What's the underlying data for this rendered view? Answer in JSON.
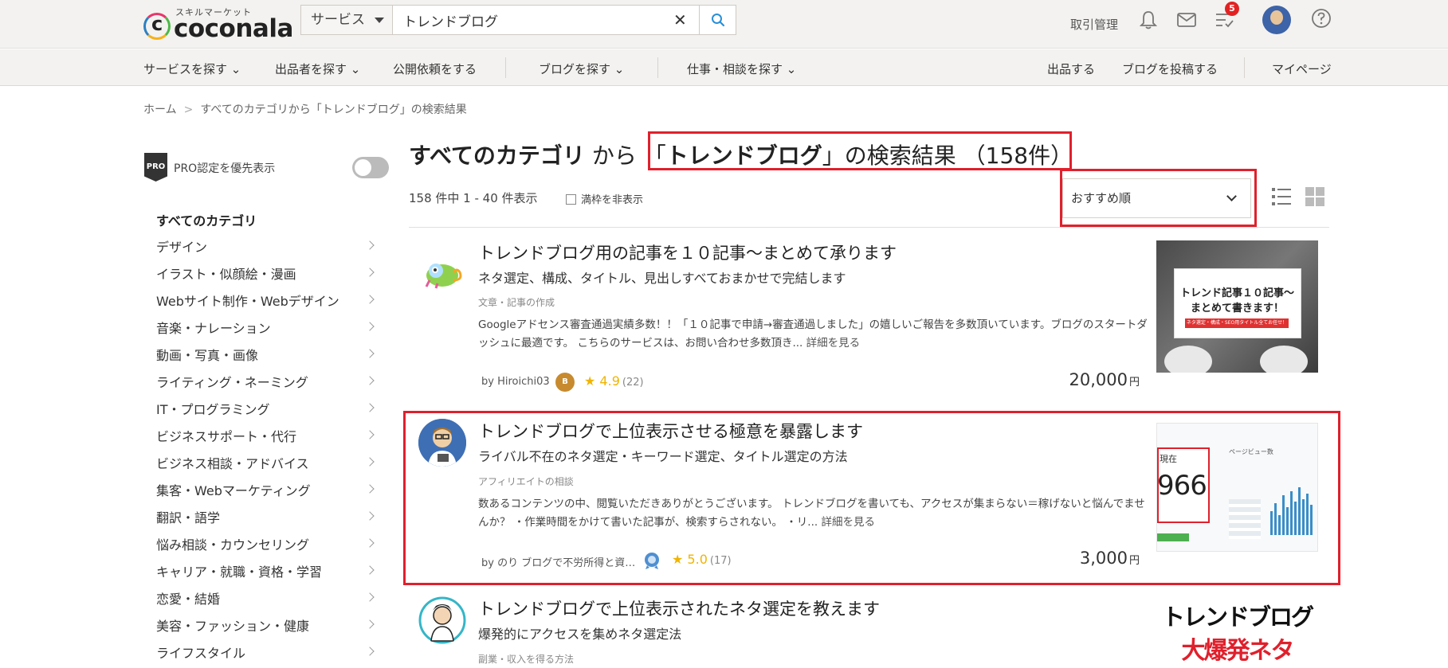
{
  "header": {
    "logo_sub": "スキルマーケット",
    "logo_text": "coconala",
    "search_category": "サービス",
    "search_value": "トレンドブログ",
    "trade_link": "取引管理",
    "notification_count": "5"
  },
  "nav": {
    "items": [
      "サービスを探す",
      "出品者を探す",
      "公開依頼をする",
      "ブログを探す",
      "仕事・相談を探す"
    ],
    "right_items": [
      "出品する",
      "ブログを投稿する",
      "マイページ"
    ]
  },
  "breadcrumb": {
    "home": "ホーム",
    "separator": ">",
    "current": "すべてのカテゴリから「トレンドブログ」の検索結果"
  },
  "sidebar": {
    "pro_badge": "PRO",
    "pro_label": "PRO認定を優先表示",
    "all_categories": "すべてのカテゴリ",
    "categories": [
      "デザイン",
      "イラスト・似顔絵・漫画",
      "Webサイト制作・Webデザイン",
      "音楽・ナレーション",
      "動画・写真・画像",
      "ライティング・ネーミング",
      "IT・プログラミング",
      "ビジネスサポート・代行",
      "ビジネス相談・アドバイス",
      "集客・Webマーケティング",
      "翻訳・語学",
      "悩み相談・カウンセリング",
      "キャリア・就職・資格・学習",
      "恋愛・結婚",
      "美容・ファッション・健康",
      "ライフスタイル"
    ]
  },
  "main": {
    "title_category": "すべてのカテゴリ",
    "title_from": "から",
    "title_open_quote": "「",
    "title_keyword": "トレンドブログ",
    "title_rest": "」の検索結果 （158件）",
    "count_text": "158 件中 1 - 40 件表示",
    "hide_full_label": "満枠を非表示",
    "sort_value": "おすすめ順"
  },
  "cards": [
    {
      "title": "トレンドブログ用の記事を１０記事〜まとめて承ります",
      "subtitle": "ネタ選定、構成、タイトル、見出しすべておまかせで完結します",
      "category": "文章・記事の作成",
      "description": "Googleアドセンス審査通過実績多数！！「１０記事で申請→審査通過しました」の嬉しいご報告を多数頂いています。ブログのスタートダッシュに最適です。 こちらのサービスは、お問い合わせ多数頂き... ",
      "more": "詳細を見る",
      "by": "by  Hiroichi03",
      "rank": "B",
      "rating": "★ 4.9",
      "reviews": "(22)",
      "price": "20,000",
      "yen": "円",
      "thumb_line1": "トレンド記事１０記事〜",
      "thumb_line2": "まとめて書きます！",
      "thumb_note": "ネタ選定・構成・SEO用タイトル全てお任せ！"
    },
    {
      "title": "トレンドブログで上位表示させる極意を暴露します",
      "subtitle": "ライバル不在のネタ選定・キーワード選定、タイトル選定の方法",
      "category": "アフィリエイトの相談",
      "description": "数あるコンテンツの中、閲覧いただきありがとうございます。 トレンドブログを書いても、アクセスが集まらない＝稼げないと悩んでませんか？ ・作業時間をかけて書いた記事が、検索すらされない。 ・リ... ",
      "more": "詳細を見る",
      "by": "by  のり ブログで不労所得と資…",
      "rating": "★ 5.0",
      "reviews": "(17)",
      "price": "3,000",
      "yen": "円",
      "thumb_now": "現在",
      "thumb_number": "966",
      "thumb_label": "ページビュー数"
    },
    {
      "title": "トレンドブログで上位表示されたネタ選定を教えます",
      "subtitle": "爆発的にアクセスを集めネタ選定法",
      "category": "副業・収入を得る方法",
      "thumb_line1": "トレンドブログ",
      "thumb_line2": "大爆発ネタ"
    }
  ],
  "colors": {
    "highlight": "#e0202c",
    "star": "#f0b400",
    "header_bg": "#f3f2f0"
  }
}
